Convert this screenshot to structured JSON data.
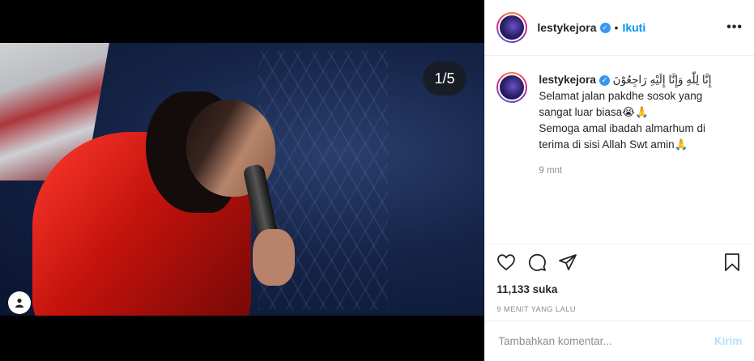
{
  "media": {
    "counter": "1/5",
    "tag_icon": "user-tag-icon"
  },
  "header": {
    "username": "lestykejora",
    "verified_icon": "verified-badge-icon",
    "separator": "•",
    "follow_label": "Ikuti",
    "more_label": "•••"
  },
  "caption": {
    "username": "lestykejora",
    "line1": "إِنَّا لِلّٰهِ وَإِنَّا إِلَيْهِ رَاجِعُوْنَ",
    "line2": "Selamat jalan pakdhe sosok yang sangat luar biasa😭🙏",
    "line3": "Semoga amal ibadah almarhum di terima di sisi Allah Swt amin🙏",
    "time": "9 mnt"
  },
  "actions": {
    "like_icon": "heart-icon",
    "comment_icon": "comment-icon",
    "share_icon": "share-icon",
    "save_icon": "bookmark-icon",
    "likes": "11,133 suka",
    "posted_ago": "9 MENIT YANG LALU"
  },
  "composer": {
    "placeholder": "Tambahkan komentar...",
    "post_label": "Kirim"
  },
  "colors": {
    "link_blue": "#0095f6",
    "verified_blue": "#3897f0",
    "disabled_blue": "#b2dffc",
    "muted_gray": "#8e8e8e"
  }
}
